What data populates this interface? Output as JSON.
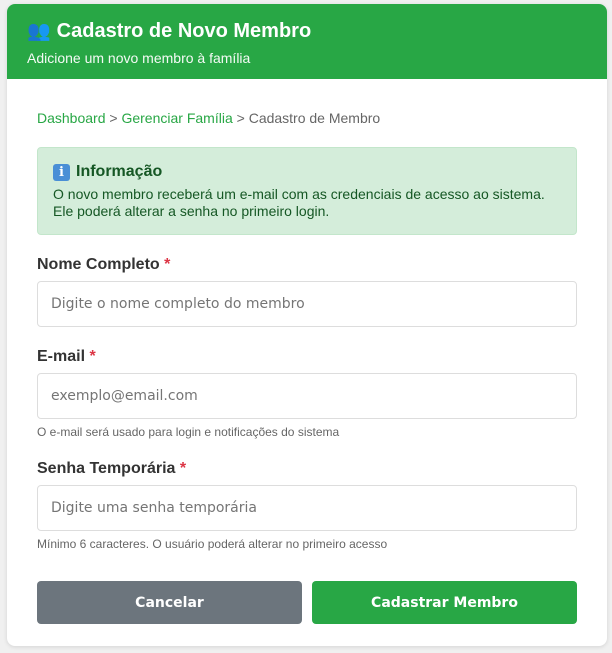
{
  "header": {
    "icon": "users-icon",
    "icon_glyph": "👥",
    "title": "Cadastro de Novo Membro",
    "subtitle": "Adicione um novo membro à família"
  },
  "breadcrumb": {
    "items": [
      "Dashboard",
      "Gerenciar Família",
      "Cadastro de Membro"
    ],
    "separator": ">"
  },
  "info": {
    "icon": "info-icon",
    "icon_glyph": "i",
    "title": "Informação",
    "line1": "O novo membro receberá um e-mail com as credenciais de acesso ao sistema.",
    "line2": "Ele poderá alterar a senha no primeiro login."
  },
  "form": {
    "name": {
      "label": "Nome Completo",
      "required_mark": "*",
      "value": "",
      "placeholder": "Digite o nome completo do membro"
    },
    "email": {
      "label": "E-mail",
      "required_mark": "*",
      "value": "",
      "placeholder": "exemplo@email.com",
      "hint": "O e-mail será usado para login e notificações do sistema"
    },
    "password": {
      "label": "Senha Temporária",
      "required_mark": "*",
      "value": "",
      "placeholder": "Digite uma senha temporária",
      "hint": "Mínimo 6 caracteres. O usuário poderá alterar no primeiro acesso"
    }
  },
  "actions": {
    "cancel_label": "Cancelar",
    "submit_label": "Cadastrar Membro"
  },
  "colors": {
    "primary": "#28a745",
    "secondary": "#6c757d",
    "info_bg": "#d4edda",
    "info_text": "#155724",
    "required": "#dc3545"
  }
}
